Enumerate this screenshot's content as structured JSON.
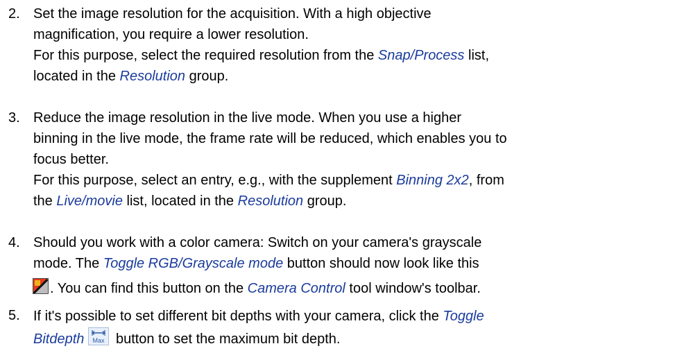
{
  "steps": [
    {
      "number": "2.",
      "l1": "Set the image resolution for the acquisition. With a high objective",
      "l2": "magnification, you require a lower resolution.",
      "l3a": "For this purpose, select the required resolution from the ",
      "l3ui": "Snap/Process",
      "l3b": " list,",
      "l4a": "located in the ",
      "l4ui": "Resolution",
      "l4b": " group."
    },
    {
      "number": "3.",
      "l1": "Reduce the image resolution in the live mode. When you use a higher",
      "l2": "binning in the live mode, the frame rate will be reduced, which enables you to",
      "l3": "focus better.",
      "l4a": "For this purpose, select an entry, e.g., with the supplement ",
      "l4ui": "Binning 2x2",
      "l4b": ", from",
      "l5a": "the ",
      "l5ui1": "Live/movie",
      "l5b": " list, located in the ",
      "l5ui2": "Resolution",
      "l5c": " group."
    },
    {
      "number": "4.",
      "l1": "Should you work with a color camera: Switch on your camera's grayscale",
      "l2a": "mode. The ",
      "l2ui": "Toggle RGB/Grayscale mode",
      "l2b": " button should now look like this",
      "l3a": ". You can find this button on the ",
      "l3ui": "Camera Control",
      "l3b": " tool window's toolbar.",
      "icon": "rgb-grayscale-toggle-icon"
    },
    {
      "number": "5.",
      "l1a": "If it's possible to set different bit depths with your camera, click the ",
      "l1ui": "Toggle",
      "l2ui": "Bitdepth",
      "l2b": " button to set the maximum bit depth.",
      "icon": "toggle-bitdepth-max-icon",
      "icon_label": "Max"
    }
  ]
}
